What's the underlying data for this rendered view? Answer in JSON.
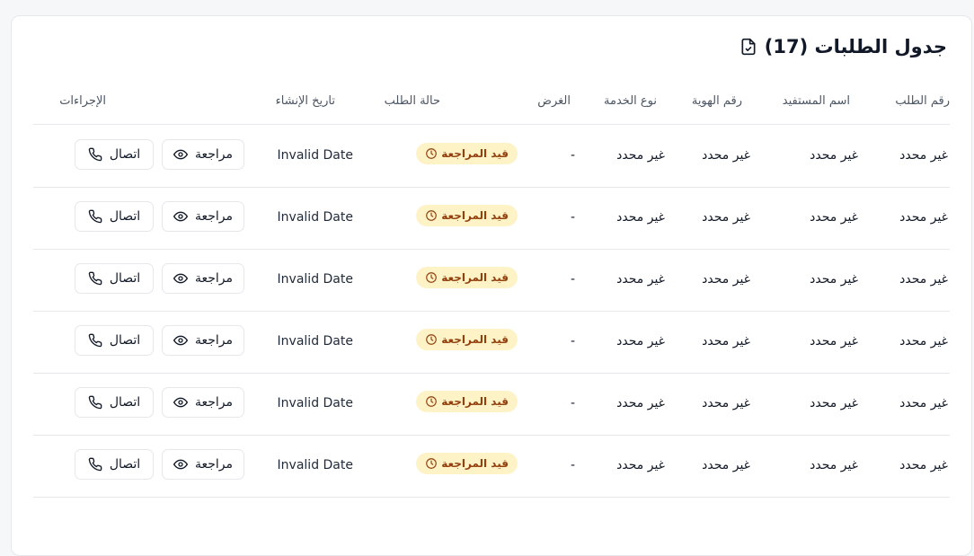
{
  "card": {
    "title": "جدول الطلبات (17)",
    "title_icon": "file-check-icon"
  },
  "table": {
    "headers": {
      "request_no": "رقم الطلب",
      "beneficiary": "اسم المستفيد",
      "id_no": "رقم الهوية",
      "service_type": "نوع الخدمة",
      "purpose": "الغرض",
      "status": "حالة الطلب",
      "created": "تاريخ الإنشاء",
      "actions": "الإجراءات"
    },
    "rows": [
      {
        "request_no": "غير محدد",
        "beneficiary": "غير محدد",
        "id_no": "غير محدد",
        "service_type": "غير محدد",
        "purpose": "-",
        "status": "قيد المراجعة",
        "created": "Invalid Date",
        "review": "مراجعة",
        "call": "اتصال"
      },
      {
        "request_no": "غير محدد",
        "beneficiary": "غير محدد",
        "id_no": "غير محدد",
        "service_type": "غير محدد",
        "purpose": "-",
        "status": "قيد المراجعة",
        "created": "Invalid Date",
        "review": "مراجعة",
        "call": "اتصال"
      },
      {
        "request_no": "غير محدد",
        "beneficiary": "غير محدد",
        "id_no": "غير محدد",
        "service_type": "غير محدد",
        "purpose": "-",
        "status": "قيد المراجعة",
        "created": "Invalid Date",
        "review": "مراجعة",
        "call": "اتصال"
      },
      {
        "request_no": "غير محدد",
        "beneficiary": "غير محدد",
        "id_no": "غير محدد",
        "service_type": "غير محدد",
        "purpose": "-",
        "status": "قيد المراجعة",
        "created": "Invalid Date",
        "review": "مراجعة",
        "call": "اتصال"
      },
      {
        "request_no": "غير محدد",
        "beneficiary": "غير محدد",
        "id_no": "غير محدد",
        "service_type": "غير محدد",
        "purpose": "-",
        "status": "قيد المراجعة",
        "created": "Invalid Date",
        "review": "مراجعة",
        "call": "اتصال"
      },
      {
        "request_no": "غير محدد",
        "beneficiary": "غير محدد",
        "id_no": "غير محدد",
        "service_type": "غير محدد",
        "purpose": "-",
        "status": "قيد المراجعة",
        "created": "Invalid Date",
        "review": "مراجعة",
        "call": "اتصال"
      }
    ]
  },
  "icons": {
    "status": "clock-icon",
    "review": "eye-icon",
    "call": "phone-icon"
  },
  "colors": {
    "status_badge_bg": "#fef3c7",
    "status_badge_text": "#92400e"
  }
}
